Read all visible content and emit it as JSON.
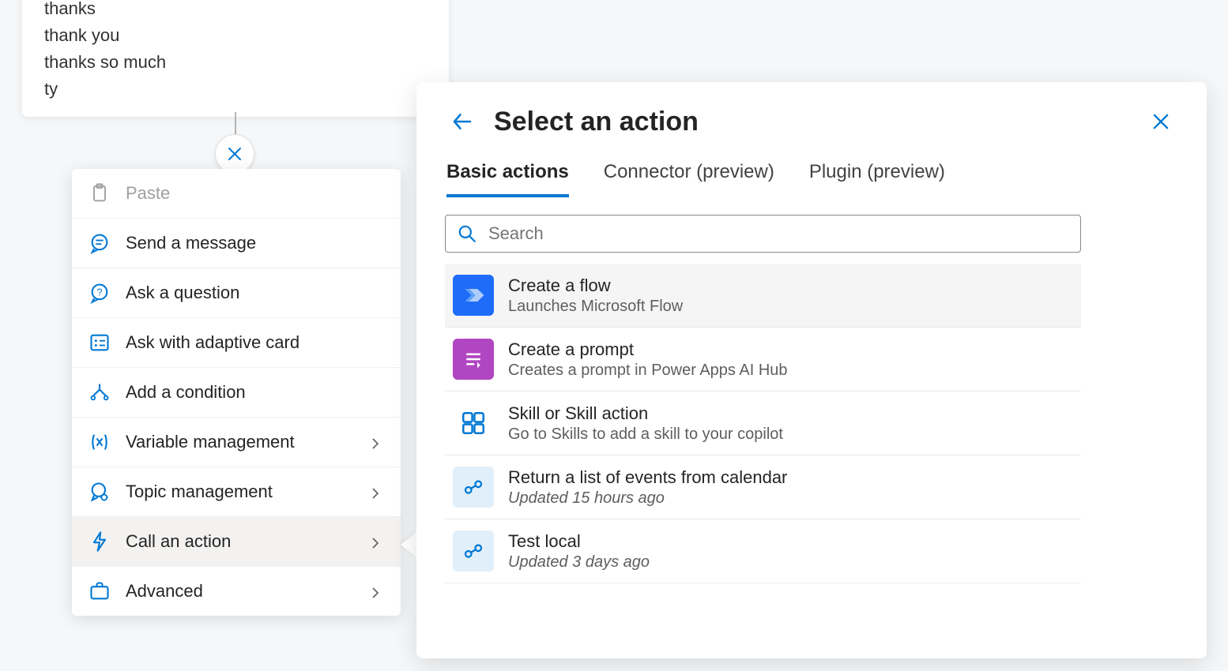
{
  "trigger_phrases": [
    "thanks",
    "thank you",
    "thanks so much",
    "ty"
  ],
  "menu": {
    "paste": "Paste",
    "items": [
      {
        "label": "Send a message",
        "icon": "message",
        "has_sub": false
      },
      {
        "label": "Ask a question",
        "icon": "question",
        "has_sub": false
      },
      {
        "label": "Ask with adaptive card",
        "icon": "card",
        "has_sub": false
      },
      {
        "label": "Add a condition",
        "icon": "condition",
        "has_sub": false
      },
      {
        "label": "Variable management",
        "icon": "variable",
        "has_sub": true
      },
      {
        "label": "Topic management",
        "icon": "topic",
        "has_sub": true
      },
      {
        "label": "Call an action",
        "icon": "action",
        "has_sub": true,
        "selected": true
      },
      {
        "label": "Advanced",
        "icon": "advanced",
        "has_sub": true
      }
    ]
  },
  "panel": {
    "title": "Select an action",
    "tabs": [
      "Basic actions",
      "Connector (preview)",
      "Plugin (preview)"
    ],
    "search_placeholder": "Search",
    "actions": [
      {
        "title": "Create a flow",
        "subtitle": "Launches Microsoft Flow",
        "icon": "flow",
        "hovered": true
      },
      {
        "title": "Create a prompt",
        "subtitle": "Creates a prompt in Power Apps AI Hub",
        "icon": "prompt"
      },
      {
        "title": "Skill or Skill action",
        "subtitle": "Go to Skills to add a skill to your copilot",
        "icon": "skill"
      },
      {
        "title": "Return a list of events from calendar",
        "subtitle": "Updated 15 hours ago",
        "icon": "cloud",
        "italic": true
      },
      {
        "title": "Test local",
        "subtitle": "Updated 3 days ago",
        "icon": "cloud",
        "italic": true
      }
    ]
  }
}
